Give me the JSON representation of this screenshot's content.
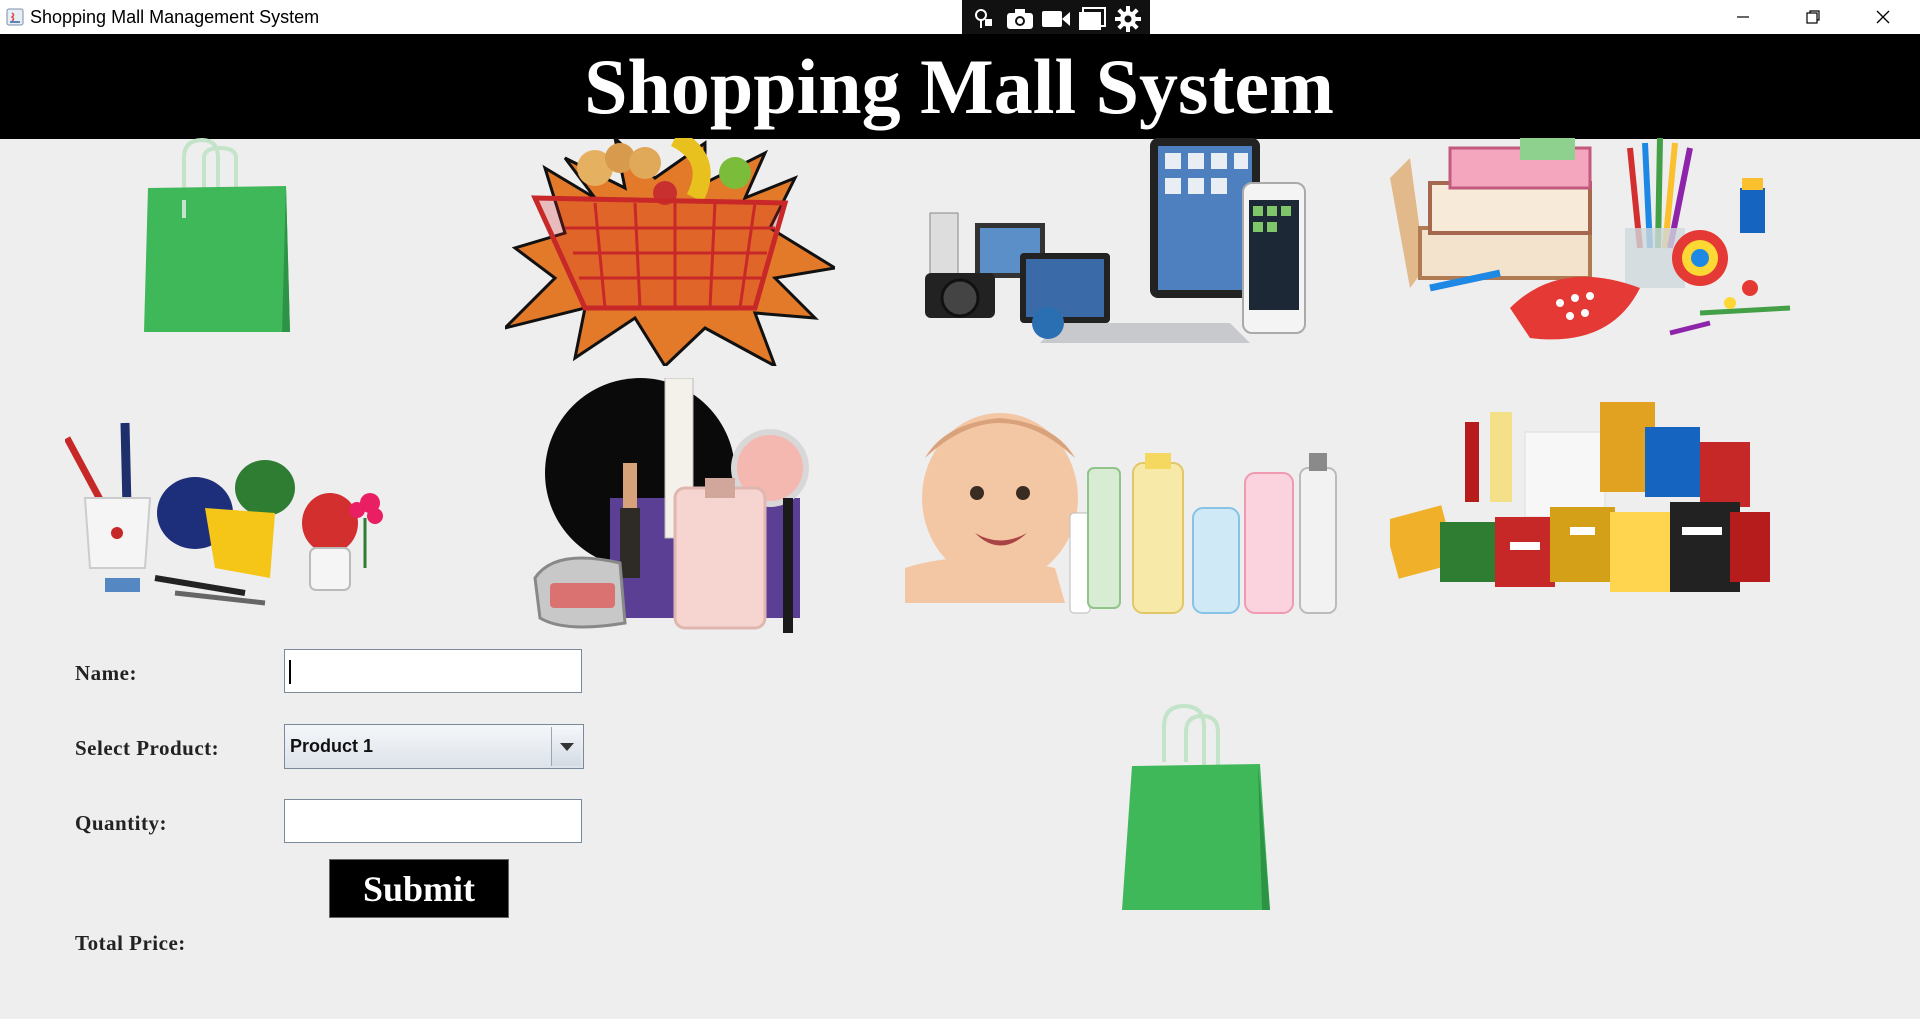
{
  "window": {
    "title": "Shopping Mall Management System",
    "controls": [
      "minimize-icon",
      "restore-icon",
      "close-icon"
    ]
  },
  "recorder_toolbar": {
    "icons": [
      "pin-icon",
      "camera-icon",
      "video-icon",
      "window-icon",
      "settings-icon"
    ]
  },
  "header": {
    "title": "Shopping Mall System",
    "background": "#000000",
    "color": "#ffffff"
  },
  "gallery": {
    "items": [
      {
        "name": "shopping-bag-image"
      },
      {
        "name": "grocery-basket-image"
      },
      {
        "name": "electronics-image"
      },
      {
        "name": "stationery-image"
      },
      {
        "name": "promotional-gifts-image"
      },
      {
        "name": "cosmetics-image"
      },
      {
        "name": "baby-products-image"
      },
      {
        "name": "snacks-image"
      }
    ]
  },
  "form": {
    "name_label": "Name:",
    "name_value": "",
    "product_label": "Select Product:",
    "product_selected": "Product 1",
    "quantity_label": "Quantity:",
    "quantity_value": "",
    "submit_label": "Submit",
    "total_label": "Total Price:",
    "total_value": ""
  },
  "colors": {
    "bag_green": "#3fb85a",
    "bag_handle": "#bfe3c6",
    "window_bg": "#eeeeee"
  }
}
